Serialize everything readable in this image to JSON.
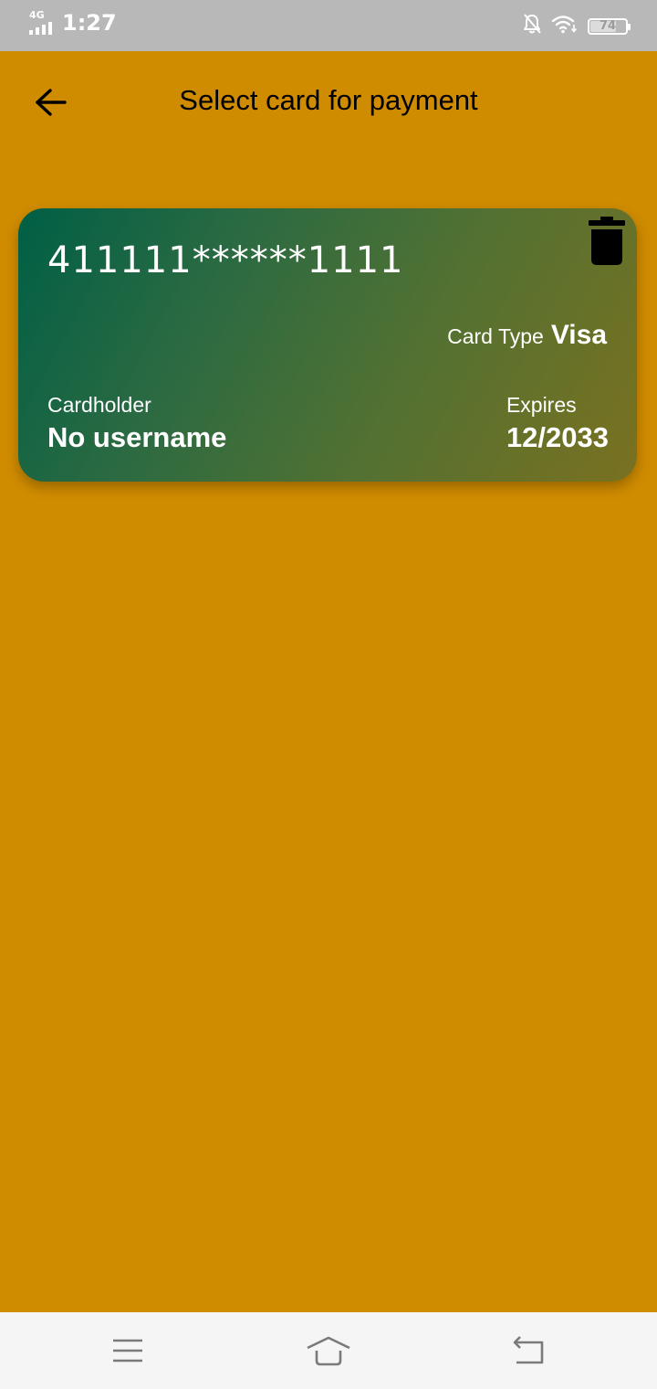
{
  "status_bar": {
    "network": "4G",
    "time": "1:27",
    "battery_level": 74,
    "battery_text": "74",
    "icons": [
      "signal-icon",
      "bell-off-icon",
      "wifi-icon",
      "battery-icon"
    ]
  },
  "header": {
    "title": "Select card for payment",
    "back_icon": "arrow-left-icon"
  },
  "cards": [
    {
      "number": "411111******1111",
      "card_type_label": "Card Type",
      "card_type": "Visa",
      "holder_label": "Cardholder",
      "holder_name": "No username",
      "expires_label": "Expires",
      "expires": "12/2033",
      "delete_icon": "trash-icon"
    }
  ],
  "nav_bar": {
    "icons": [
      "menu-icon",
      "home-icon",
      "back-icon"
    ]
  },
  "colors": {
    "background": "#D08C00",
    "status_bar": "#B8B8B8",
    "card_gradient_start": "#005F45",
    "card_gradient_end": "#7A7120",
    "nav_bar": "#F5F5F5"
  }
}
